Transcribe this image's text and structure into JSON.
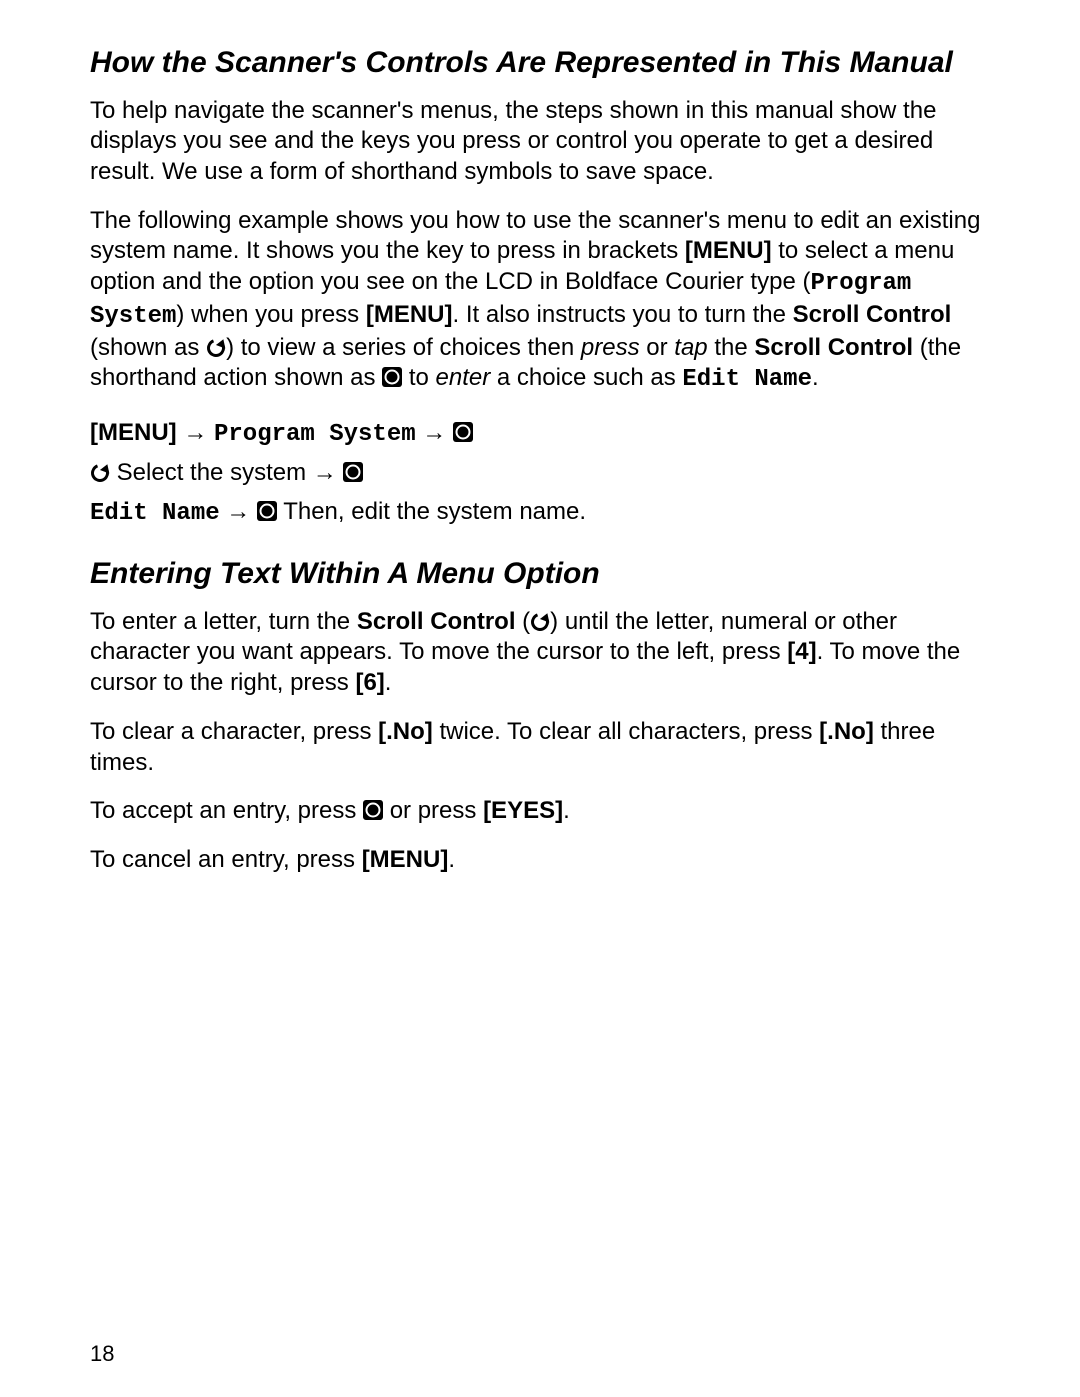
{
  "section1": {
    "heading": "How the Scanner's Controls Are Represented in This Manual",
    "para1": "To help navigate the scanner's menus, the steps shown in this manual show the displays you see and the keys you press or control you operate to get a desired result. We use a form of shorthand symbols to save space.",
    "para2": {
      "t1": "The following example shows you how to use the scanner's menu to edit an existing system name. It shows you the key to press in brackets ",
      "menu1": "[MENU]",
      "t2": " to select a menu option and the option you see on the LCD in Boldface Courier type (",
      "program_system": "Program System",
      "t3": ") when you press ",
      "menu2": "[MENU]",
      "t4": ". It also instructs you to turn the ",
      "scroll_control1": "Scroll Control",
      "t5": " (shown as ",
      "t6": ") to view a series of choices then ",
      "press": "press",
      "t7": " or ",
      "tap": "tap",
      "t8": " the ",
      "scroll_control2": "Scroll Control",
      "t9": " (the shorthand action shown as ",
      "t10": " to ",
      "enter": "enter",
      "t11": " a choice such as ",
      "edit_name": "Edit Name",
      "t12": "."
    },
    "steps": {
      "menu": "[MENU]",
      "arrow": " → ",
      "program_system": "Program System",
      "select_system": " Select the system ",
      "edit_name": "Edit Name",
      "then_edit": " Then, edit the system name."
    }
  },
  "section2": {
    "heading": "Entering Text Within A Menu Option",
    "para1": {
      "t1": "To enter a letter, turn the ",
      "scroll_control": "Scroll Control",
      "t2": " (",
      "t3": ") until the letter, numeral or other character you want appears. To move the cursor to the left, press ",
      "key4": "[4]",
      "t4": ". To move the cursor to the right, press ",
      "key6": "[6]",
      "t5": "."
    },
    "para2": {
      "t1": "To clear a character, press ",
      "no1": "[.No]",
      "t2": " twice. To clear all characters, press ",
      "no2": "[.No]",
      "t3": " three times."
    },
    "para3": {
      "t1": "To accept an entry, press ",
      "t2": " or press ",
      "eyes": "[EYES]",
      "t3": "."
    },
    "para4": {
      "t1": "To cancel an entry, press ",
      "menu": "[MENU]",
      "t2": "."
    }
  },
  "page_number": "18"
}
